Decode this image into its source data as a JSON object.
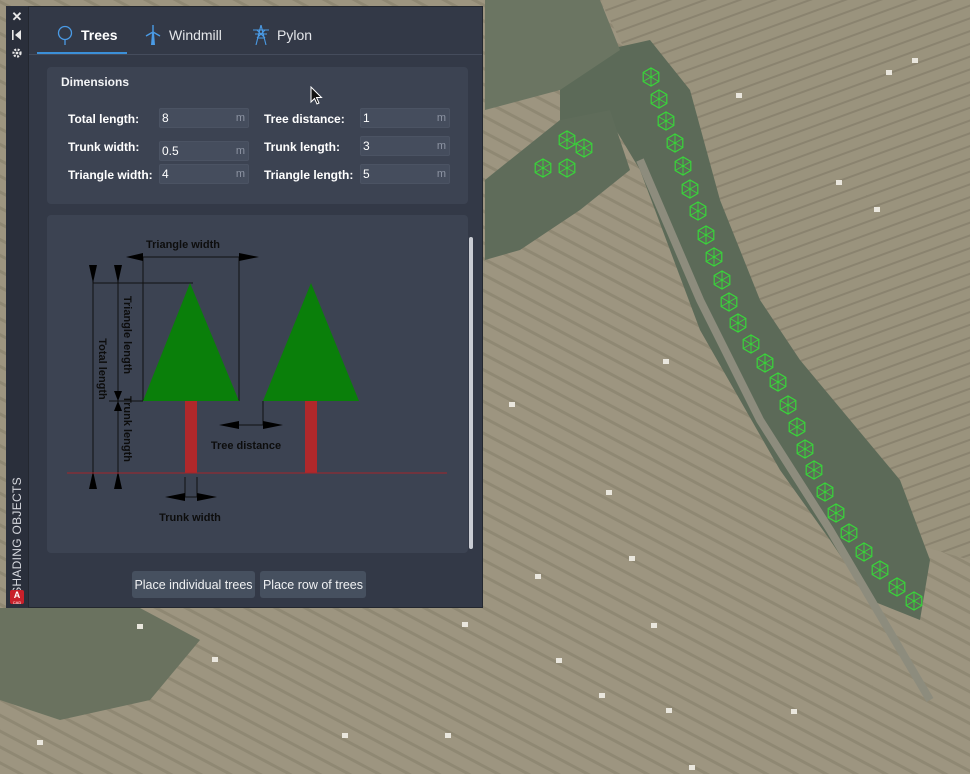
{
  "sidebar": {
    "title": "SHADING OBJECTS",
    "logo_letter": "A",
    "logo_sub": "CAD"
  },
  "tabs": [
    {
      "label": "Trees",
      "icon": "tree-icon",
      "active": true
    },
    {
      "label": "Windmill",
      "icon": "windmill-icon",
      "active": false
    },
    {
      "label": "Pylon",
      "icon": "pylon-icon",
      "active": false
    }
  ],
  "dimensions": {
    "heading": "Dimensions",
    "unit": "m",
    "total_length": {
      "label": "Total length:",
      "value": "8"
    },
    "tree_distance": {
      "label": "Tree distance:",
      "value": "1"
    },
    "trunk_width": {
      "label": "Trunk width:",
      "value": "0.5"
    },
    "trunk_length": {
      "label": "Trunk length:",
      "value": "3"
    },
    "triangle_width": {
      "label": "Triangle width:",
      "value": "4"
    },
    "triangle_length": {
      "label": "Triangle length:",
      "value": "5"
    }
  },
  "diagram": {
    "triangle_width": "Triangle width",
    "triangle_length": "Triangle length",
    "total_length": "Total length",
    "trunk_length": "Trunk length",
    "tree_distance": "Tree distance",
    "trunk_width": "Trunk width"
  },
  "buttons": {
    "place_individual": "Place individual trees",
    "place_row": "Place row of trees"
  },
  "colors": {
    "canopy": "#0a7f0a",
    "trunk": "#b0282b",
    "ground_line": "#a3262a",
    "marker": "#39d43a",
    "accent": "#3b8fd8"
  }
}
